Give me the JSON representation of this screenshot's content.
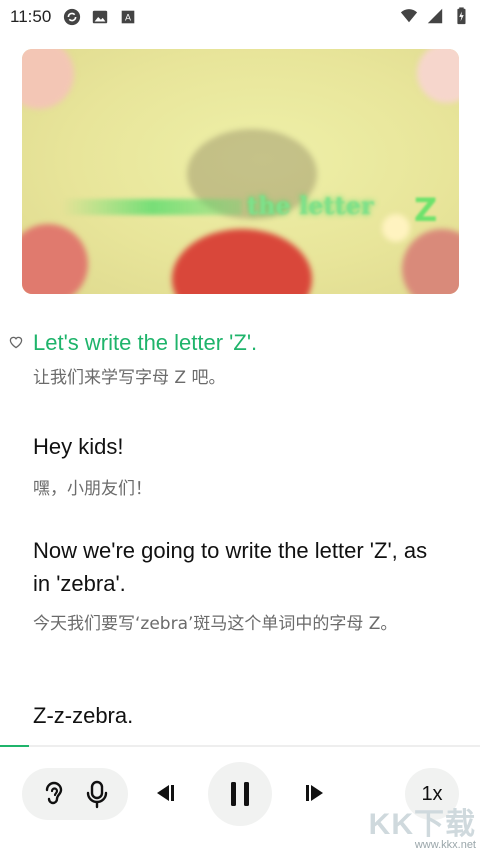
{
  "status_bar": {
    "time": "11:50",
    "left_icons": [
      "sync-icon",
      "image-icon",
      "text-a-icon"
    ],
    "right_icons": [
      "wifi-icon",
      "signal-icon",
      "battery-charging-icon"
    ]
  },
  "video": {
    "overlay_text": "the letter",
    "overlay_letter": "Z"
  },
  "transcript": {
    "active_color": "#1fb46b",
    "entries": [
      {
        "en": "Let's write the letter 'Z'.",
        "zh": "让我们来学写字母 Z 吧。",
        "active": true,
        "favorite_icon": "heart-outline-icon"
      },
      {
        "en": "Hey kids!",
        "zh": "嘿，小朋友们！"
      },
      {
        "en": "Now we're going to write the letter 'Z', as in 'zebra'.",
        "zh": "今天我们要写‘zebra’斑马这个单词中的字母 Z。"
      },
      {
        "en": "Z-z-zebra.",
        "zh": ""
      }
    ]
  },
  "playback": {
    "progress": 0.06,
    "speed_label": "1x",
    "buttons": [
      "ear-icon",
      "microphone-icon",
      "previous-icon",
      "pause-icon",
      "next-icon"
    ]
  },
  "watermark": {
    "logo": "KK下载",
    "url": "www.kkx.net"
  }
}
